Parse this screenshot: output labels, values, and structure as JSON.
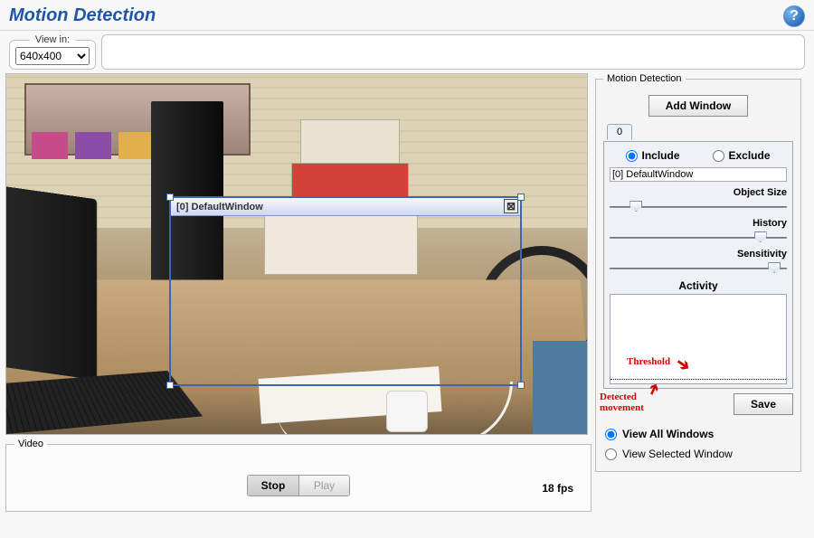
{
  "title": "Motion Detection",
  "help_icon_glyph": "?",
  "view_in": {
    "legend": "View in:",
    "selected": "640x400"
  },
  "video": {
    "legend": "Video",
    "stop_label": "Stop",
    "play_label": "Play",
    "fps_text": "18 fps",
    "active_button": "stop"
  },
  "overlay": {
    "title": "[0] DefaultWindow",
    "close_glyph": "⊠"
  },
  "panel": {
    "legend": "Motion Detection",
    "add_window_label": "Add Window",
    "tab_label": "0",
    "include_label": "Include",
    "exclude_label": "Exclude",
    "mode": "include",
    "window_name": "[0] DefaultWindow",
    "sliders": {
      "object_size": {
        "label": "Object Size",
        "value": 15
      },
      "history": {
        "label": "History",
        "value": 85
      },
      "sensitivity": {
        "label": "Sensitivity",
        "value": 93
      }
    },
    "activity_label": "Activity",
    "threshold_text": "Threshold",
    "save_label": "Save",
    "detected_text1": "Detected",
    "detected_text2": "movement",
    "view_all_label": "View All Windows",
    "view_selected_label": "View Selected Window",
    "view_mode": "all"
  }
}
